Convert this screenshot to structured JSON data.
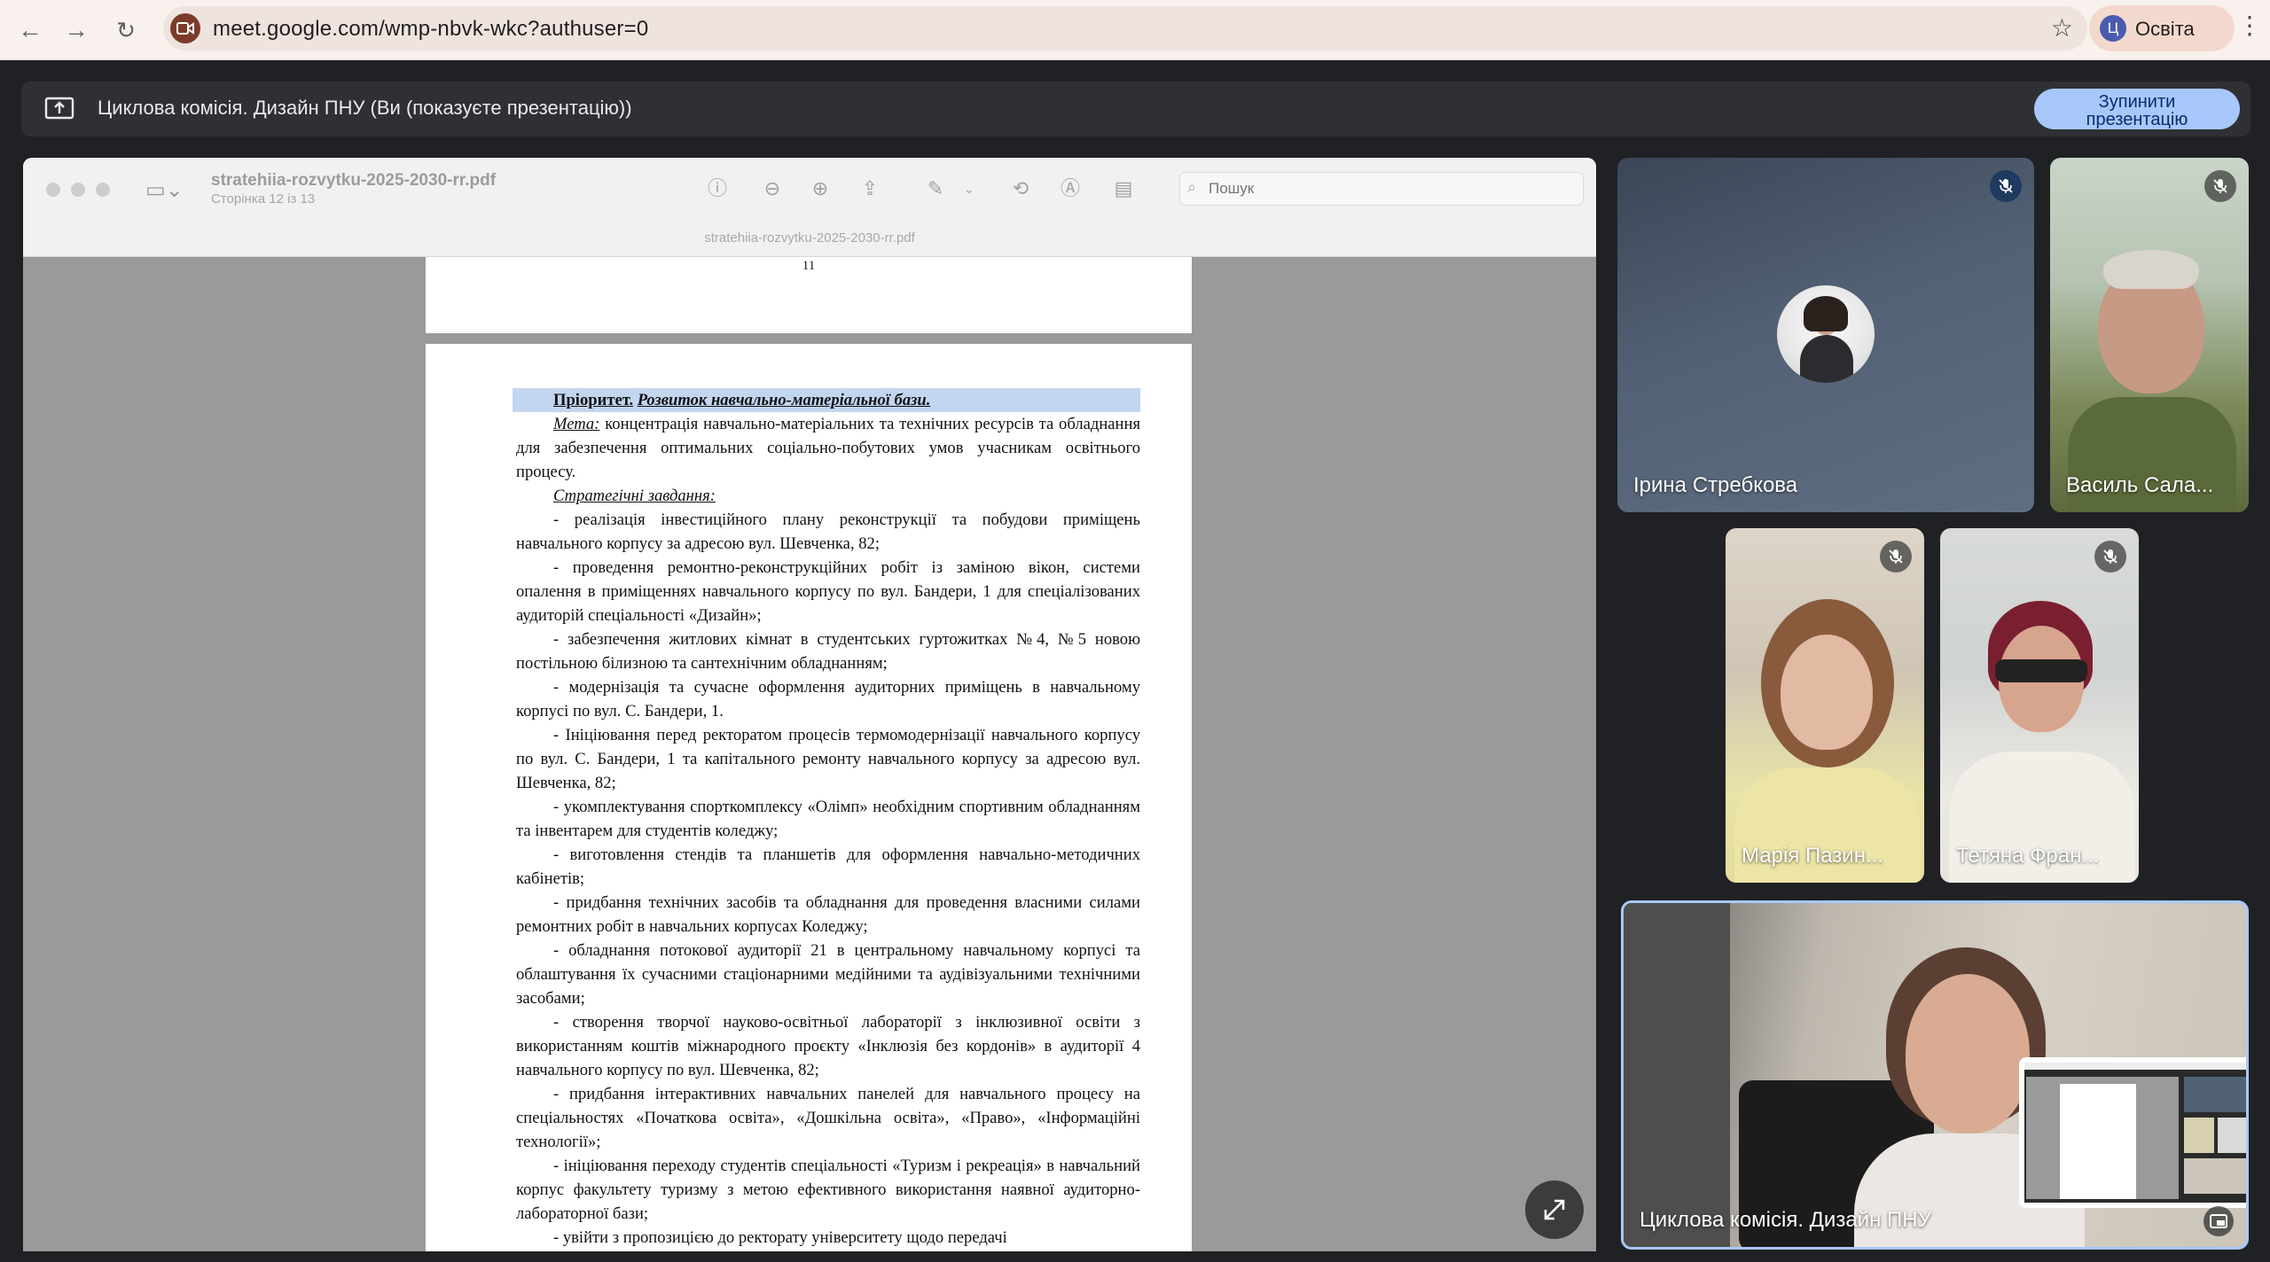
{
  "browser": {
    "url": "meet.google.com/wmp-nbvk-wkc?authuser=0",
    "profile_initial": "Ц",
    "profile_name": "Освіта"
  },
  "presenting_bar": {
    "text": "Циклова комісія. Дизайн ПНУ (Ви (показуєте презентацію))",
    "stop_line1": "Зупинити",
    "stop_line2": "презентацію"
  },
  "viewer": {
    "file_title": "stratehiia-rozvytku-2025-2030-rr.pdf",
    "page_info": "Сторінка 12 із 13",
    "search_placeholder": "Пошук",
    "window_filename": "stratehiia-rozvytku-2025-2030-rr.pdf",
    "prev_page_number": "11"
  },
  "document": {
    "priority_label": "Пріоритет.",
    "priority_title": "Розвиток навчально-матеріальної бази.",
    "goal_label": "Мета:",
    "goal_text": "концентрація навчально-матеріальних та технічних ресурсів та обладнання для забезпечення оптимальних соціально-побутових умов учасникам освітнього процесу.",
    "tasks_label": "Стратегічні завдання:",
    "tasks": [
      "- реалізація інвестиційного плану реконструкції та побудови приміщень навчального корпусу за адресою вул. Шевченка, 82;",
      "- проведення ремонтно-реконструкційних робіт із заміною вікон, системи опалення в приміщеннях навчального корпусу по вул. Бандери, 1 для спеціалізованих аудиторій спеціальності «Дизайн»;",
      "- забезпечення житлових кімнат в студентських гуртожитках №4, №5 новою постільною білизною та сантехнічним обладнанням;",
      "- модернізація та сучасне оформлення аудиторних приміщень в навчальному корпусі по вул. С. Бандери, 1.",
      "- Ініціювання перед ректоратом процесів термомодернізації навчального корпусу по вул. С. Бандери, 1 та капітального ремонту навчального корпусу за адресою вул. Шевченка, 82;",
      "- укомплектування спорткомплексу «Олімп» необхідним спортивним обладнанням та інвентарем для студентів коледжу;",
      "- виготовлення стендів та планшетів для оформлення навчально-методичних кабінетів;",
      "- придбання технічних засобів та обладнання для проведення власними силами ремонтних робіт в навчальних корпусах Коледжу;",
      "- обладнання потокової аудиторії 21 в центральному навчальному корпусі та облаштування їх сучасними стаціонарними медійними та аудівізуальними технічними засобами;",
      "- створення творчої науково-освітньої лабораторії з інклюзивної освіти з використанням коштів міжнародного проєкту «Інклюзія без кордонів» в аудиторії 4 навчального корпусу по вул. Шевченка, 82;",
      "- придбання інтерактивних навчальних панелей для навчального процесу на спеціальностях «Початкова освіта», «Дошкільна освіта», «Право», «Інформаційні технології»;",
      "- ініціювання переходу студентів спеціальності «Туризм і рекреація» в навчальний корпус факультету туризму з метою ефективного використання наявної аудиторно-лабораторної бази;",
      "- увійти з пропозицією до ректорату університету щодо передачі"
    ]
  },
  "participants": [
    {
      "name": "Ірина Стребкова"
    },
    {
      "name": "Василь Сала..."
    },
    {
      "name": "Марія Пазин..."
    },
    {
      "name": "Тетяна Фран..."
    },
    {
      "name": "Циклова комісія. Дизайн ПНУ"
    }
  ],
  "colors": {
    "accent": "#a8c7fa",
    "meet_bg": "#202124",
    "highlight": "#c3d6f0"
  }
}
